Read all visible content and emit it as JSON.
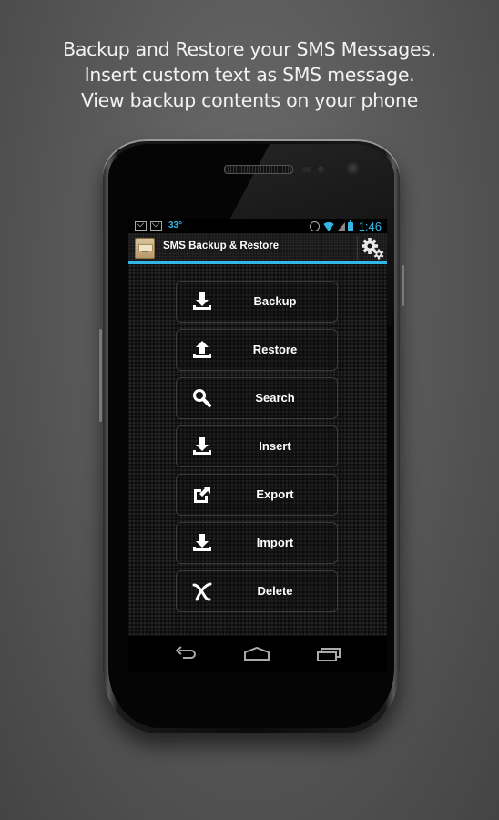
{
  "promo": {
    "lines": [
      "Backup and Restore your SMS Messages.",
      "Insert custom text as SMS message.",
      "View backup contents on your phone"
    ]
  },
  "status_bar": {
    "notifications": [
      "gmail-icon",
      "gmail-icon"
    ],
    "temperature": "33°",
    "icons": [
      "alarm-icon",
      "wifi-icon",
      "signal-icon",
      "battery-icon"
    ],
    "time": "1:46"
  },
  "action_bar": {
    "title": "SMS Backup & Restore",
    "app_icon": "drawer-icon",
    "settings_icon": "gears-icon"
  },
  "menu": {
    "items": [
      {
        "label": "Backup",
        "icon": "download-icon"
      },
      {
        "label": "Restore",
        "icon": "upload-icon"
      },
      {
        "label": "Search",
        "icon": "search-icon"
      },
      {
        "label": "Insert",
        "icon": "download-icon"
      },
      {
        "label": "Export",
        "icon": "external-link-icon"
      },
      {
        "label": "Import",
        "icon": "download-icon"
      },
      {
        "label": "Delete",
        "icon": "delete-icon"
      }
    ]
  },
  "nav_bar": {
    "items": [
      "back-icon",
      "home-icon",
      "recents-icon"
    ]
  },
  "colors": {
    "accent": "#33b5e5",
    "background": "#5a5a5a",
    "text": "#ffffff"
  }
}
